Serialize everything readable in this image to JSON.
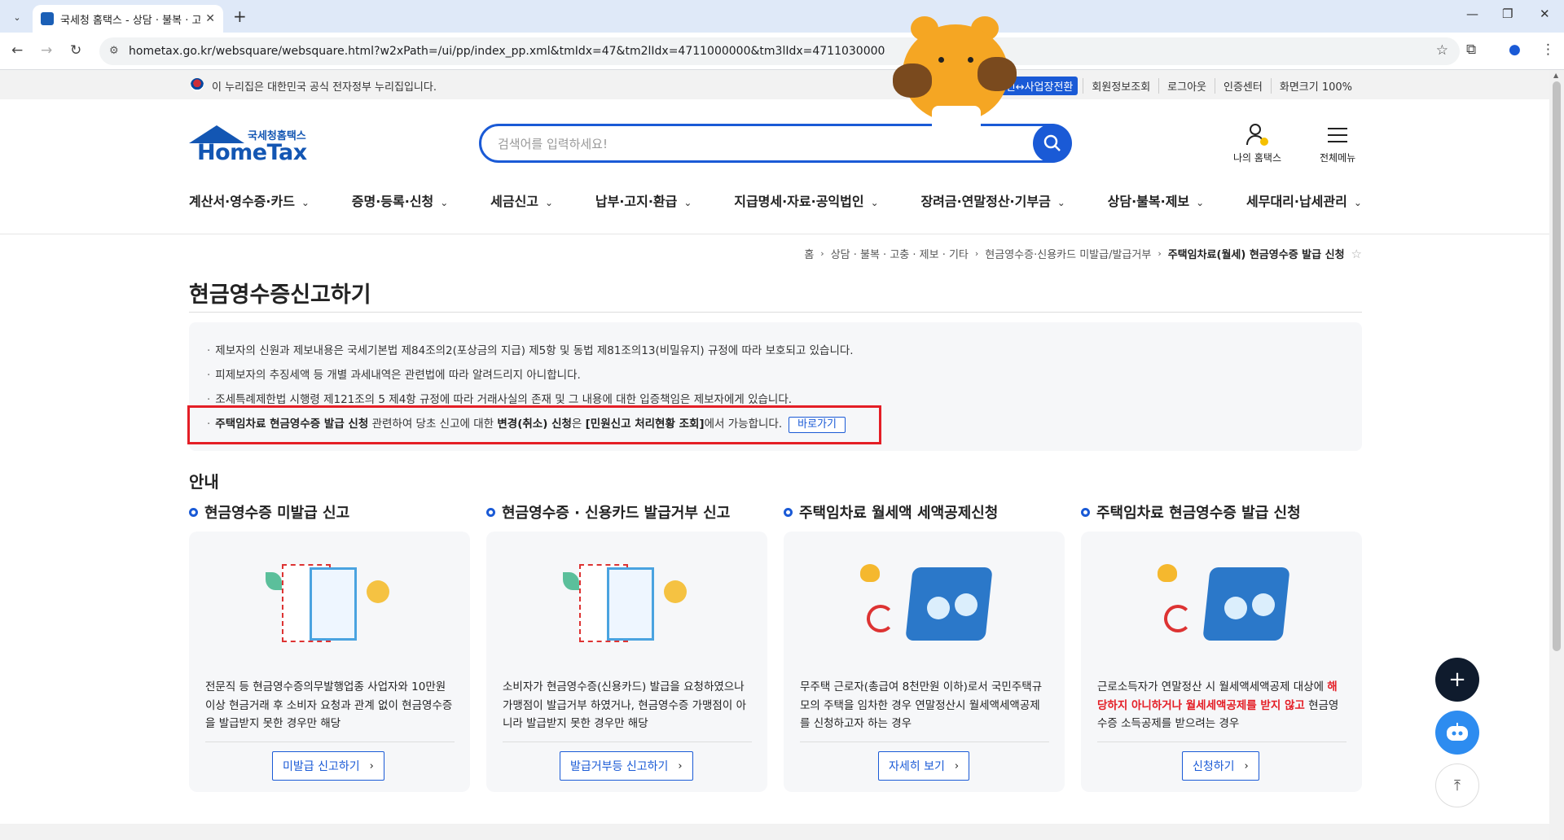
{
  "browser": {
    "tab_title": "국세청 홈택스 - 상담 · 불복 · 고충",
    "url": "hometax.go.kr/websquare/websquare.html?w2xPath=/ui/pp/index_pp.xml&tmIdx=47&tm2lIdx=4711000000&tm3lIdx=4711030000"
  },
  "gov_bar": {
    "text": "이 누리집은 대한민국 공식 전자정부 누리집입니다.",
    "tag": "개인↔사업장전환",
    "links": [
      "회원정보조회",
      "로그아웃",
      "인증센터",
      "화면크기 100%"
    ]
  },
  "header": {
    "logo_kor": "국세청홈택스",
    "logo_en": "HomeTax",
    "search_placeholder": "검색어를 입력하세요!",
    "my_hometax": "나의 홈택스",
    "all_menu": "전체메뉴"
  },
  "gnb": [
    "계산서·영수증·카드",
    "증명·등록·신청",
    "세금신고",
    "납부·고지·환급",
    "지급명세·자료·공익법인",
    "장려금·연말정산·기부금",
    "상담·불복·제보",
    "세무대리·납세관리"
  ],
  "breadcrumb": [
    "홈",
    "상담 · 불복 · 고충 · 제보 · 기타",
    "현금영수증·신용카드 미발급/발급거부",
    "주택임차료(월세) 현금영수증 발급 신청"
  ],
  "page_title": "현금영수증신고하기",
  "notice": {
    "line1": "제보자의 신원과 제보내용은 국세기본법 제84조의2(포상금의 지급) 제5항 및 동법 제81조의13(비밀유지) 규정에 따라 보호되고 있습니다.",
    "line2": "피제보자의 추징세액 등 개별 과세내역은 관련법에 따라 알려드리지 아니합니다.",
    "line3": "조세특례제한법 시행령 제121조의 5 제4항 규정에 따라 거래사실의 존재 및 그 내용에 대한 입증책임은 제보자에게 있습니다.",
    "line4_a": "주택임차료 현금영수증 발급 신청",
    "line4_b": " 관련하여 당초 신고에 대한 ",
    "line4_c": "변경(취소) 신청",
    "line4_d": "은 ",
    "line4_e": "[민원신고 처리현황 조회]",
    "line4_f": "에서 가능합니다.",
    "go_button": "바로가기"
  },
  "guide_title": "안내",
  "cards": [
    {
      "title": "현금영수증 미발급 신고",
      "text": "전문직 등 현금영수증의무발행업종 사업자와 10만원 이상 현금거래 후 소비자 요청과 관계 없이 현금영수증을 발급받지 못한 경우만 해당",
      "button": "미발급 신고하기"
    },
    {
      "title": "현금영수증 · 신용카드 발급거부 신고",
      "text": "소비자가 현금영수증(신용카드) 발급을 요청하였으나 가맹점이 발급거부 하였거나, 현금영수증 가맹점이 아니라 발급받지 못한 경우만 해당",
      "button": "발급거부등 신고하기"
    },
    {
      "title": "주택임차료 월세액 세액공제신청",
      "text": "무주택 근로자(총급여 8천만원 이하)로서 국민주택규모의 주택을 임차한 경우 연말정산시 월세액세액공제를 신청하고자 하는 경우",
      "button": "자세히 보기"
    },
    {
      "title": "주택임차료 현금영수증 발급 신청",
      "text_a": "근로소득자가 연말정산 시 월세액세액공제 대상에 ",
      "text_red": "해당하지 아니하거나 월세세액공제를 받지 않고",
      "text_b": " 현금영수증 소득공제를 받으려는 경우",
      "button": "신청하기"
    }
  ]
}
